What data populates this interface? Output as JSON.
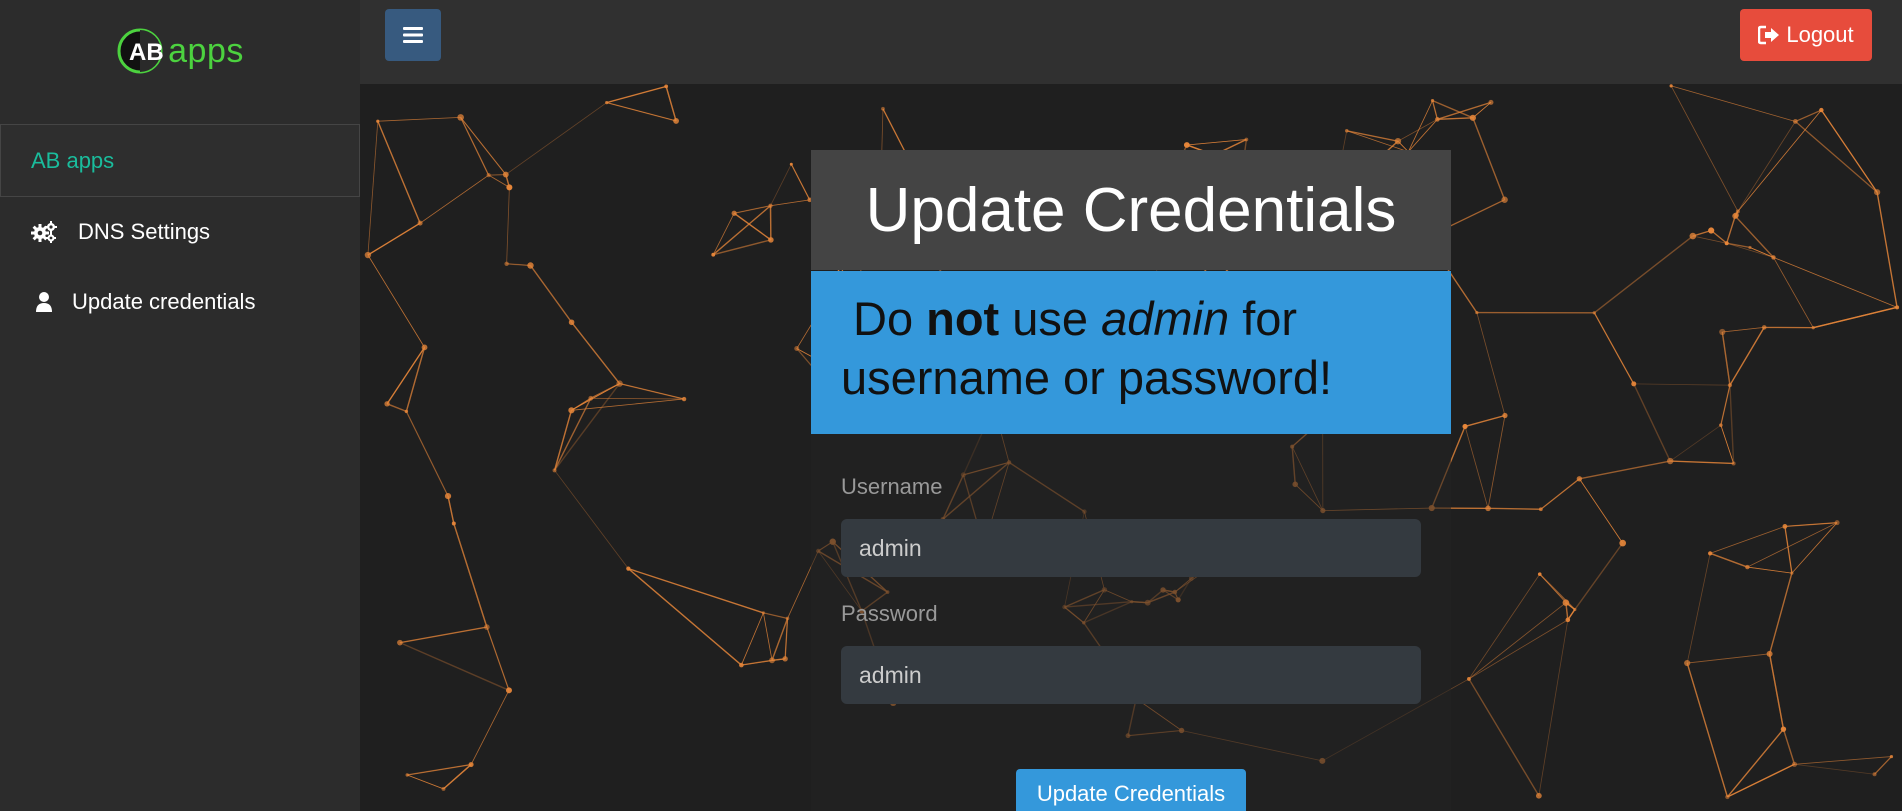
{
  "brand": {
    "name": "apps",
    "logo_letters": "AB"
  },
  "sidebar": {
    "items": [
      {
        "label": "AB apps",
        "icon": "none"
      },
      {
        "label": "DNS Settings",
        "icon": "gears-icon"
      },
      {
        "label": "Update credentials",
        "icon": "user-icon"
      }
    ]
  },
  "topbar": {
    "menu_icon": "hamburger-icon",
    "logout_label": "Logout"
  },
  "card": {
    "title": "Update Credentials",
    "warning": {
      "part1": "Do ",
      "bold": "not",
      "part2": " use ",
      "italic": "admin",
      "part3": " for",
      "line2": "username or password!"
    }
  },
  "form": {
    "username_label": "Username",
    "username_value": "admin",
    "password_label": "Password",
    "password_value": "admin",
    "submit_label": "Update Credentials"
  },
  "colors": {
    "brand_green": "#4cd23f",
    "active_teal": "#1abc9c",
    "menu_blue": "#375a7f",
    "logout_red": "#e74c3c",
    "alert_blue": "#3498db",
    "network_orange": "#e8873a"
  }
}
